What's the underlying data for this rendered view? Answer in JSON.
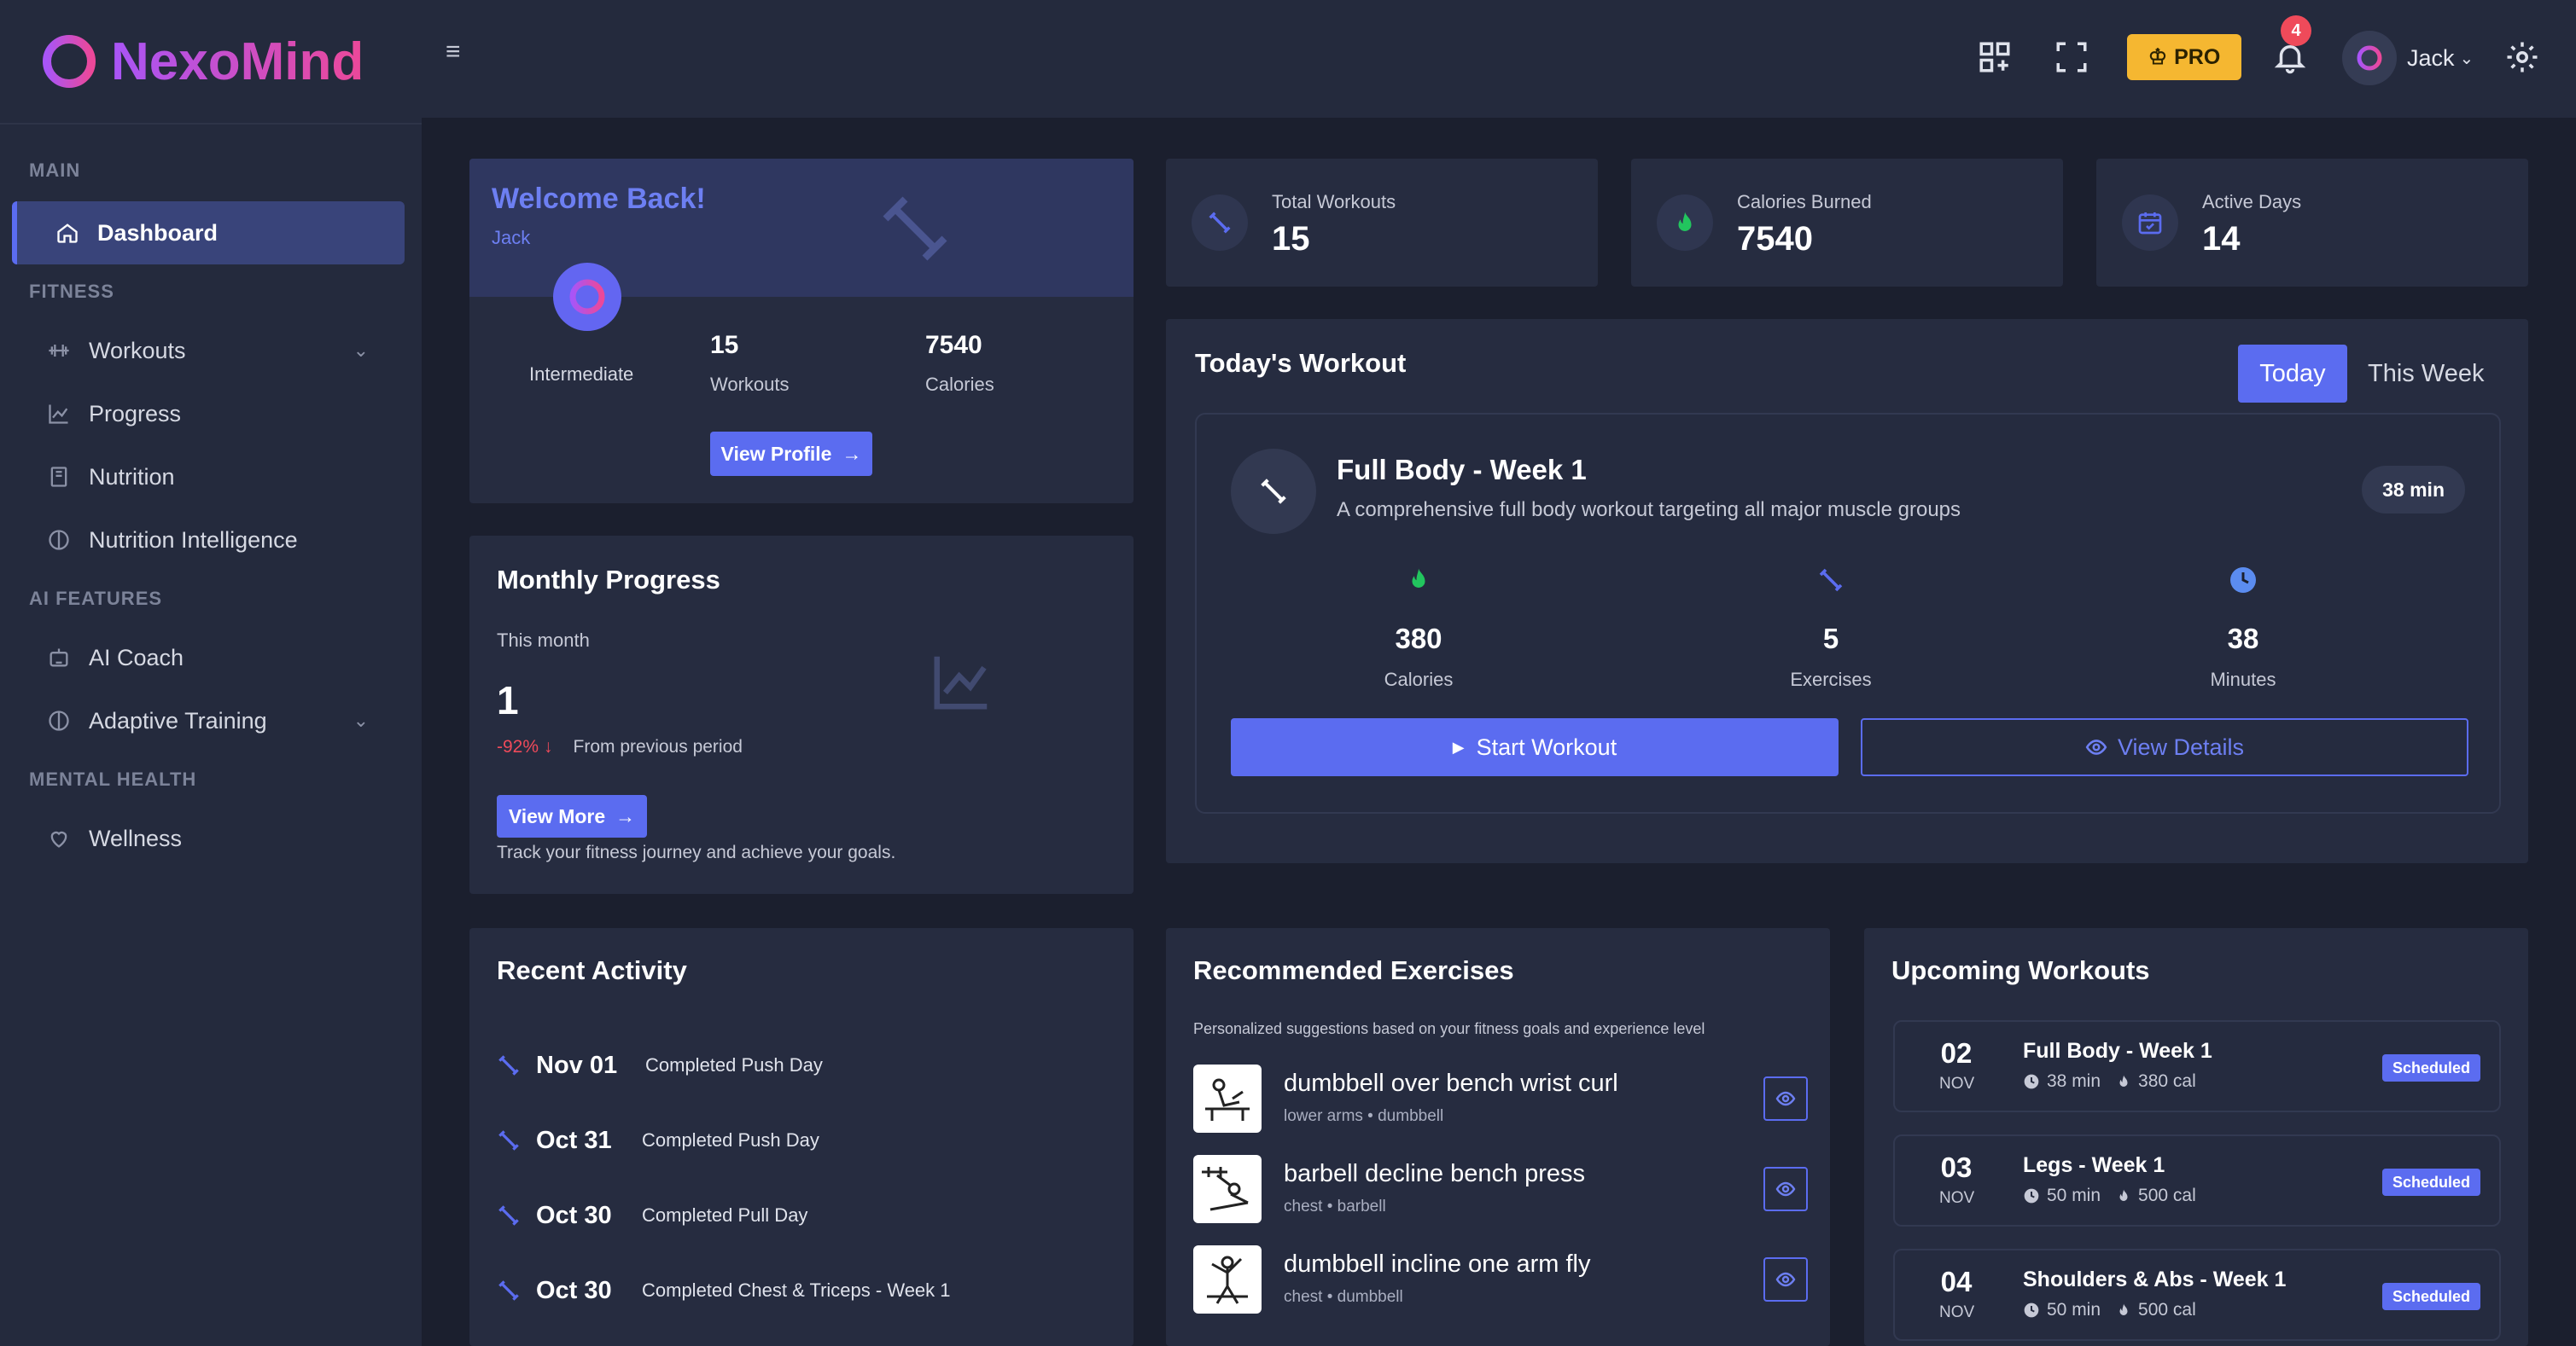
{
  "brand": {
    "name": "NexoMind"
  },
  "sidebar": {
    "sections": {
      "main": "MAIN",
      "fitness": "FITNESS",
      "ai": "AI FEATURES",
      "mental": "MENTAL HEALTH"
    },
    "items": {
      "dashboard": "Dashboard",
      "workouts": "Workouts",
      "progress": "Progress",
      "nutrition": "Nutrition",
      "nutrition_intel": "Nutrition Intelligence",
      "ai_coach": "AI Coach",
      "adaptive": "Adaptive Training",
      "wellness": "Wellness"
    }
  },
  "header": {
    "pro_label": "PRO",
    "notification_count": "4",
    "user_name": "Jack"
  },
  "welcome": {
    "title": "Welcome Back!",
    "user": "Jack",
    "level": "Intermediate",
    "workouts_value": "15",
    "workouts_label": "Workouts",
    "calories_value": "7540",
    "calories_label": "Calories",
    "button": "View Profile"
  },
  "stats": {
    "total_workouts": {
      "label": "Total Workouts",
      "value": "15"
    },
    "calories_burned": {
      "label": "Calories Burned",
      "value": "7540"
    },
    "active_days": {
      "label": "Active Days",
      "value": "14"
    }
  },
  "monthly": {
    "title": "Monthly Progress",
    "period": "This month",
    "value": "1",
    "change": "-92%",
    "change_label": "From previous period",
    "button": "View More",
    "footer": "Track your fitness journey and achieve your goals."
  },
  "today": {
    "title": "Today's Workout",
    "tab_today": "Today",
    "tab_week": "This Week",
    "workout_name": "Full Body - Week 1",
    "workout_desc": "A comprehensive full body workout targeting all major muscle groups",
    "duration": "38 min",
    "calories_value": "380",
    "calories_label": "Calories",
    "exercises_value": "5",
    "exercises_label": "Exercises",
    "minutes_value": "38",
    "minutes_label": "Minutes",
    "start_button": "Start Workout",
    "details_button": "View Details"
  },
  "recent": {
    "title": "Recent Activity",
    "items": [
      {
        "date": "Nov 01",
        "text": "Completed Push Day"
      },
      {
        "date": "Oct 31",
        "text": "Completed Push Day"
      },
      {
        "date": "Oct 30",
        "text": "Completed Pull Day"
      },
      {
        "date": "Oct 30",
        "text": "Completed Chest & Triceps - Week 1"
      }
    ]
  },
  "recommended": {
    "title": "Recommended Exercises",
    "subtitle": "Personalized suggestions based on your fitness goals and experience level",
    "items": [
      {
        "name": "dumbbell over bench wrist curl",
        "meta": "lower arms • dumbbell"
      },
      {
        "name": "barbell decline bench press",
        "meta": "chest • barbell"
      },
      {
        "name": "dumbbell incline one arm fly",
        "meta": "chest • dumbbell"
      }
    ]
  },
  "upcoming": {
    "title": "Upcoming Workouts",
    "items": [
      {
        "day": "02",
        "month": "NOV",
        "title": "Full Body - Week 1",
        "duration": "38 min",
        "calories": "380 cal",
        "status": "Scheduled"
      },
      {
        "day": "03",
        "month": "NOV",
        "title": "Legs - Week 1",
        "duration": "50 min",
        "calories": "500 cal",
        "status": "Scheduled"
      },
      {
        "day": "04",
        "month": "NOV",
        "title": "Shoulders & Abs - Week 1",
        "duration": "50 min",
        "calories": "500 cal",
        "status": "Scheduled"
      }
    ]
  },
  "colors": {
    "accent": "#5b6cf0",
    "background": "#1b1f2e",
    "card": "#262c40",
    "pro": "#f5b731",
    "danger": "#ef4a5a",
    "flame": "#22c55e"
  }
}
